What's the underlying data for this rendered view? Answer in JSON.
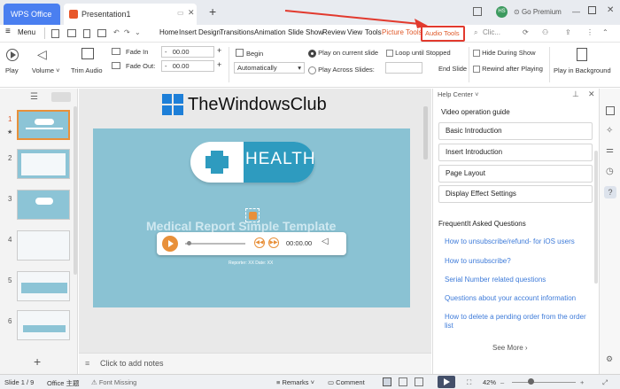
{
  "tabs": {
    "wps": "WPS Office",
    "presentation": "Presentation1",
    "go_premium": "Go Premium",
    "avatar": "HS"
  },
  "menu": {
    "menu_label": "Menu",
    "items": [
      "Home",
      "Insert",
      "Design",
      "Transitions",
      "Animation",
      "Slide Show",
      "Review",
      "View",
      "Tools"
    ],
    "picture_tools": "Picture Tools",
    "audio_tools": "Audio Tools",
    "search": "Clic..."
  },
  "ribbon": {
    "play": "Play",
    "volume": "Volume",
    "trim": "Trim Audio",
    "fade_in_label": "Fade In",
    "fade_in_value": "00.00",
    "fade_out_label": "Fade Out:",
    "fade_out_value": "00.00",
    "begin": "Begin",
    "begin_value": "Automatically",
    "play_current": "Play on current slide",
    "play_across": "Play Across Slides:",
    "loop": "Loop until Stopped",
    "end_slide": "End Slide",
    "hide": "Hide During Show",
    "rewind": "Rewind after Playing",
    "background": "Play in Background"
  },
  "slides": {
    "numbers": [
      "1",
      "2",
      "3",
      "4",
      "5",
      "6"
    ],
    "star": "★"
  },
  "slide": {
    "watermark": "TheWindowsClub",
    "health": "HEALTH",
    "title": "Medical Report Simple Template",
    "reporter": "Reporter: XX     Date: XX",
    "audio_time": "00:00.00"
  },
  "notes": {
    "placeholder": "Click to add notes"
  },
  "help": {
    "title": "Help Center",
    "section1": "Video operation guide",
    "buttons": [
      "Basic Introduction",
      "Insert Introduction",
      "Page Layout",
      "Display Effect Settings"
    ],
    "section2": "FrequentIt Asked Questions",
    "links": [
      "How to unsubscribe/refund- for iOS users",
      "How to unsubscribe?",
      "Serial Number related questions",
      "Questions about your account information",
      "How to delete a pending order from the order list"
    ],
    "see_more": "See More"
  },
  "status": {
    "slide": "Slide 1 / 9",
    "theme": "Office 主题",
    "font": "Font Missing",
    "remarks": "Remarks",
    "comment": "Comment",
    "zoom": "42%"
  },
  "colors": {
    "accent_red": "#e23a2e",
    "slide_bg": "#8ac2d3",
    "link": "#3e7bd9"
  }
}
